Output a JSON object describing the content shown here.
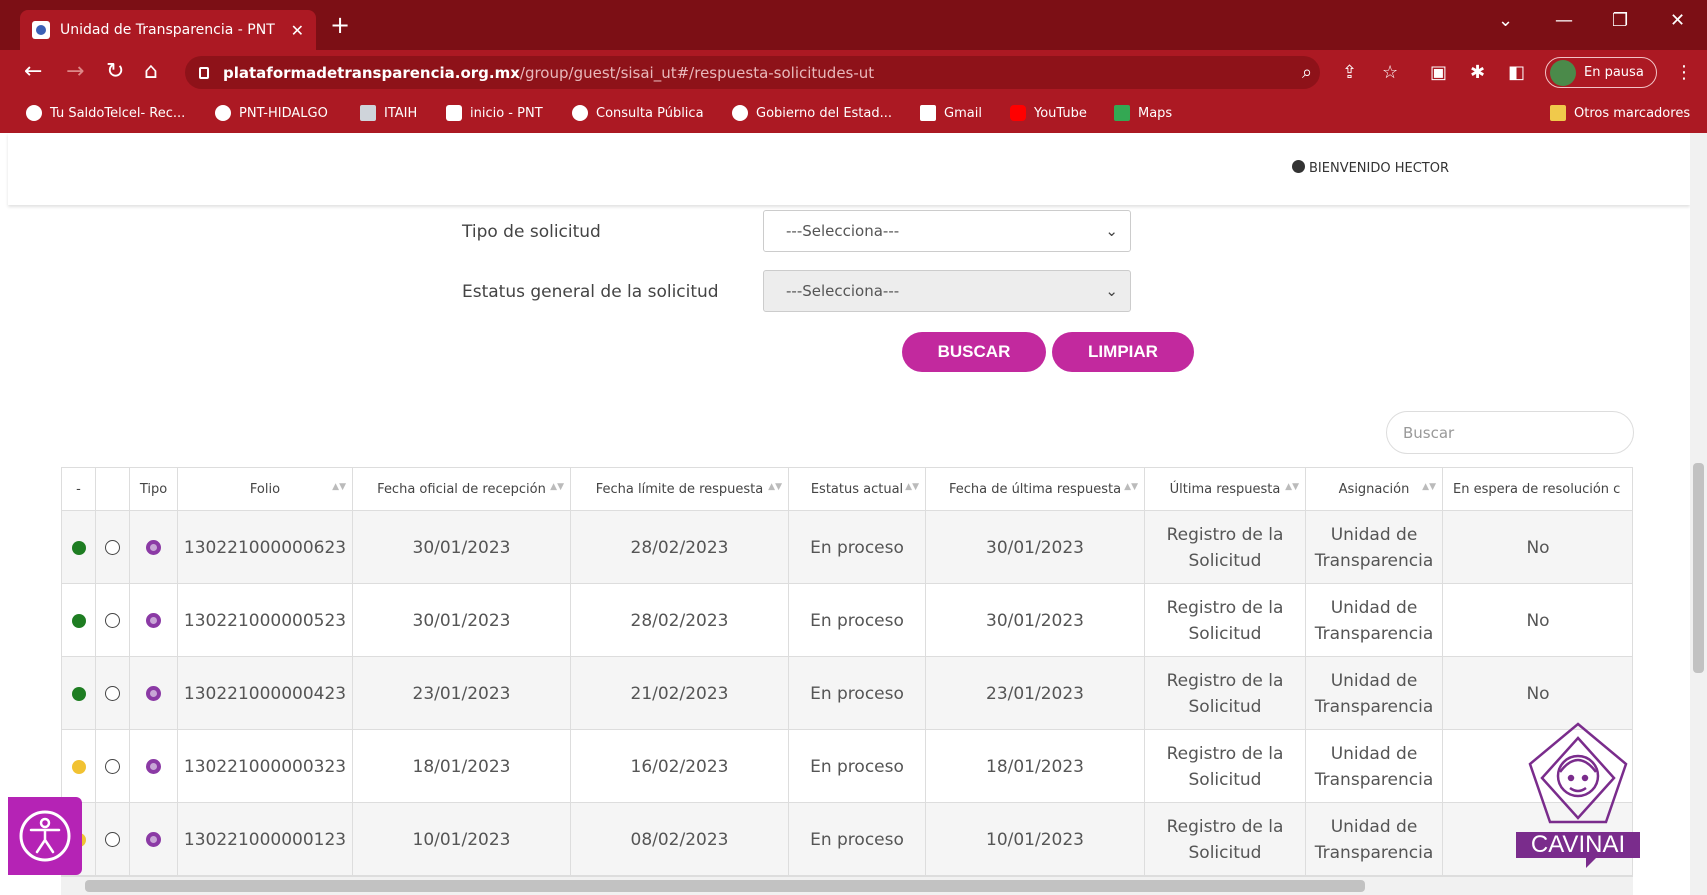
{
  "browser": {
    "tab_title": "Unidad de Transparencia - PNT",
    "url_host": "plataformadetransparencia.org.mx",
    "url_path": "/group/guest/sisai_ut#/respuesta-solicitudes-ut",
    "profile_status": "En pausa",
    "bookmarks": [
      {
        "label": "Tu SaldoTelcel- Rec..."
      },
      {
        "label": "PNT-HIDALGO"
      },
      {
        "label": "ITAIH"
      },
      {
        "label": "inicio - PNT"
      },
      {
        "label": "Consulta Pública"
      },
      {
        "label": "Gobierno del Estad..."
      },
      {
        "label": "Gmail"
      },
      {
        "label": "YouTube"
      },
      {
        "label": "Maps"
      }
    ],
    "other_bookmarks": "Otros marcadores"
  },
  "header": {
    "welcome": "BIENVENIDO HECTOR"
  },
  "filters": {
    "tipo_label": "Tipo de solicitud",
    "tipo_value": "---Selecciona---",
    "estatus_label": "Estatus general de la solicitud",
    "estatus_value": "---Selecciona---",
    "buscar_label": "BUSCAR",
    "limpiar_label": "LIMPIAR"
  },
  "search": {
    "placeholder": "Buscar"
  },
  "table": {
    "headers": [
      "-",
      "",
      "Tipo",
      "Folio",
      "Fecha oficial de recepción",
      "Fecha límite de respuesta",
      "Estatus actual",
      "Fecha de última respuesta",
      "Última respuesta",
      "Asignación",
      "En espera de resolución c"
    ],
    "rows": [
      {
        "indicator": "#1e7d22",
        "folio": "130221000000623",
        "fecha_recepcion": "30/01/2023",
        "fecha_limite": "28/02/2023",
        "estatus": "En proceso",
        "fecha_ultima": "30/01/2023",
        "ultima_respuesta": "Registro de la Solicitud",
        "asignacion": "Unidad de Transparencia",
        "espera": "No"
      },
      {
        "indicator": "#1e7d22",
        "folio": "130221000000523",
        "fecha_recepcion": "30/01/2023",
        "fecha_limite": "28/02/2023",
        "estatus": "En proceso",
        "fecha_ultima": "30/01/2023",
        "ultima_respuesta": "Registro de la Solicitud",
        "asignacion": "Unidad de Transparencia",
        "espera": "No"
      },
      {
        "indicator": "#1e7d22",
        "folio": "130221000000423",
        "fecha_recepcion": "23/01/2023",
        "fecha_limite": "21/02/2023",
        "estatus": "En proceso",
        "fecha_ultima": "23/01/2023",
        "ultima_respuesta": "Registro de la Solicitud",
        "asignacion": "Unidad de Transparencia",
        "espera": "No"
      },
      {
        "indicator": "#f1c232",
        "folio": "130221000000323",
        "fecha_recepcion": "18/01/2023",
        "fecha_limite": "16/02/2023",
        "estatus": "En proceso",
        "fecha_ultima": "18/01/2023",
        "ultima_respuesta": "Registro de la Solicitud",
        "asignacion": "Unidad de Transparencia",
        "espera": ""
      },
      {
        "indicator": "#f1c232",
        "folio": "130221000000123",
        "fecha_recepcion": "10/01/2023",
        "fecha_limite": "08/02/2023",
        "estatus": "En proceso",
        "fecha_ultima": "10/01/2023",
        "ultima_respuesta": "Registro de la Solicitud",
        "asignacion": "Unidad de Transparencia",
        "espera": ""
      }
    ]
  },
  "widgets": {
    "cavinai": "CAVINAI",
    "brand_color": "#c2299e"
  }
}
